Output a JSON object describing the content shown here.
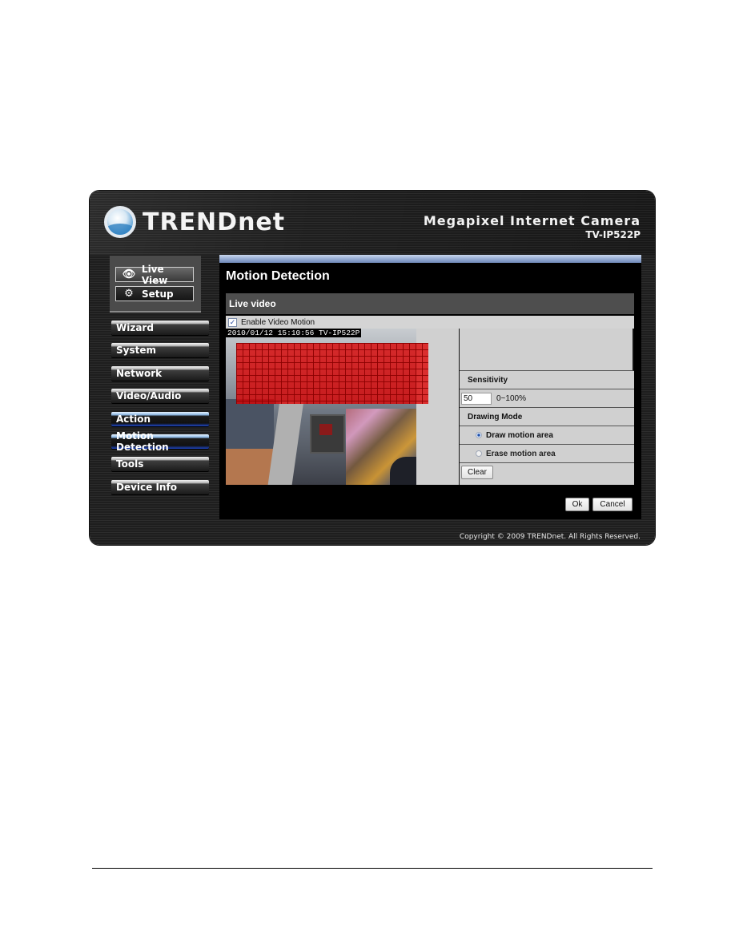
{
  "brand": {
    "logo_text": "TRENDnet",
    "logo_icon": "trendnet-globe-icon",
    "product_name": "Megapixel Internet Camera",
    "model": "TV-IP522P"
  },
  "top_nav": [
    {
      "label": "Live View",
      "icon": "eye-icon"
    },
    {
      "label": "Setup",
      "icon": "gears-icon"
    }
  ],
  "sidebar": {
    "items": [
      {
        "label": "Wizard",
        "active": false
      },
      {
        "label": "System",
        "active": false
      },
      {
        "label": "Network",
        "active": false
      },
      {
        "label": "Video/Audio",
        "active": false
      },
      {
        "label": "Action",
        "active": true
      },
      {
        "label": "Motion Detection",
        "active": true
      },
      {
        "label": "Tools",
        "active": false
      },
      {
        "label": "Device Info",
        "active": false
      }
    ]
  },
  "main": {
    "page_title": "Motion Detection",
    "section_title": "Live video",
    "enable_motion": {
      "label": "Enable Video Motion",
      "checked": true
    },
    "video": {
      "timestamp": "2010/01/12 15:10:56 TV-IP522P",
      "motion_grid_color": "#dd0000"
    },
    "sensitivity": {
      "label": "Sensitivity",
      "value": "50",
      "range_text": "0~100%"
    },
    "drawing_mode": {
      "label": "Drawing Mode",
      "options": [
        {
          "label": "Draw motion area",
          "selected": true
        },
        {
          "label": "Erase motion area",
          "selected": false
        }
      ]
    },
    "clear_label": "Clear",
    "ok_label": "Ok",
    "cancel_label": "Cancel"
  },
  "footer": {
    "copyright": "Copyright © 2009 TRENDnet. All Rights Reserved."
  },
  "colors": {
    "accent_bar": "#98aed4",
    "active_menu_underline": "#1f48c8"
  }
}
